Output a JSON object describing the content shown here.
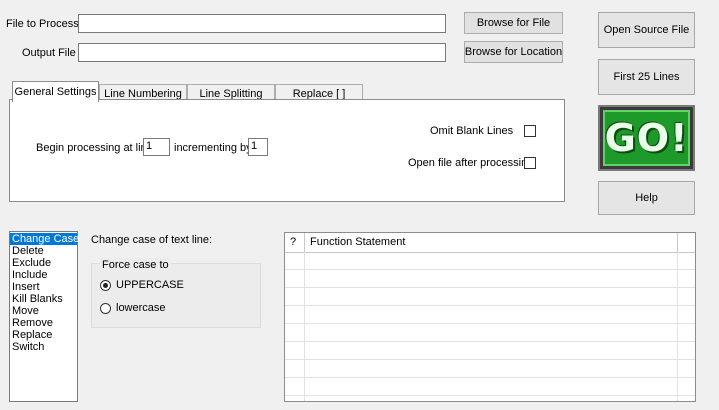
{
  "files": {
    "file_label": "File to Process",
    "file_value": "",
    "output_label": "Output File",
    "output_value": "",
    "browse_file": "Browse for File",
    "browse_location": "Browse for Location"
  },
  "side_buttons": {
    "open_source": "Open Source File",
    "first_lines": "First 25 Lines",
    "go": "GO!",
    "help": "Help"
  },
  "tabs": [
    {
      "label": "General Settings",
      "active": true
    },
    {
      "label": "Line Numbering"
    },
    {
      "label": "Line Splitting"
    },
    {
      "label": "Replace [ ]"
    }
  ],
  "general": {
    "begin_label": "Begin processing at line",
    "begin_value": "1",
    "increment_label": "incrementing by",
    "increment_value": "1",
    "omit_blank": "Omit Blank Lines",
    "omit_blank_checked": false,
    "open_after": "Open file after processing",
    "open_after_checked": false
  },
  "functions": {
    "items": [
      "Change Case",
      "Delete",
      "Exclude",
      "Include",
      "Insert",
      "Kill Blanks",
      "Move",
      "Remove",
      "Replace",
      "Switch"
    ],
    "selected": "Change Case"
  },
  "change_case": {
    "title": "Change case of text line:",
    "group_label": "Force case to",
    "options": [
      "UPPERCASE",
      "lowercase"
    ],
    "selected": "UPPERCASE"
  },
  "grid": {
    "columns": [
      "?",
      "Function Statement"
    ]
  },
  "colors": {
    "selection": "#0078d7",
    "go_green": "#1e9a2a"
  }
}
